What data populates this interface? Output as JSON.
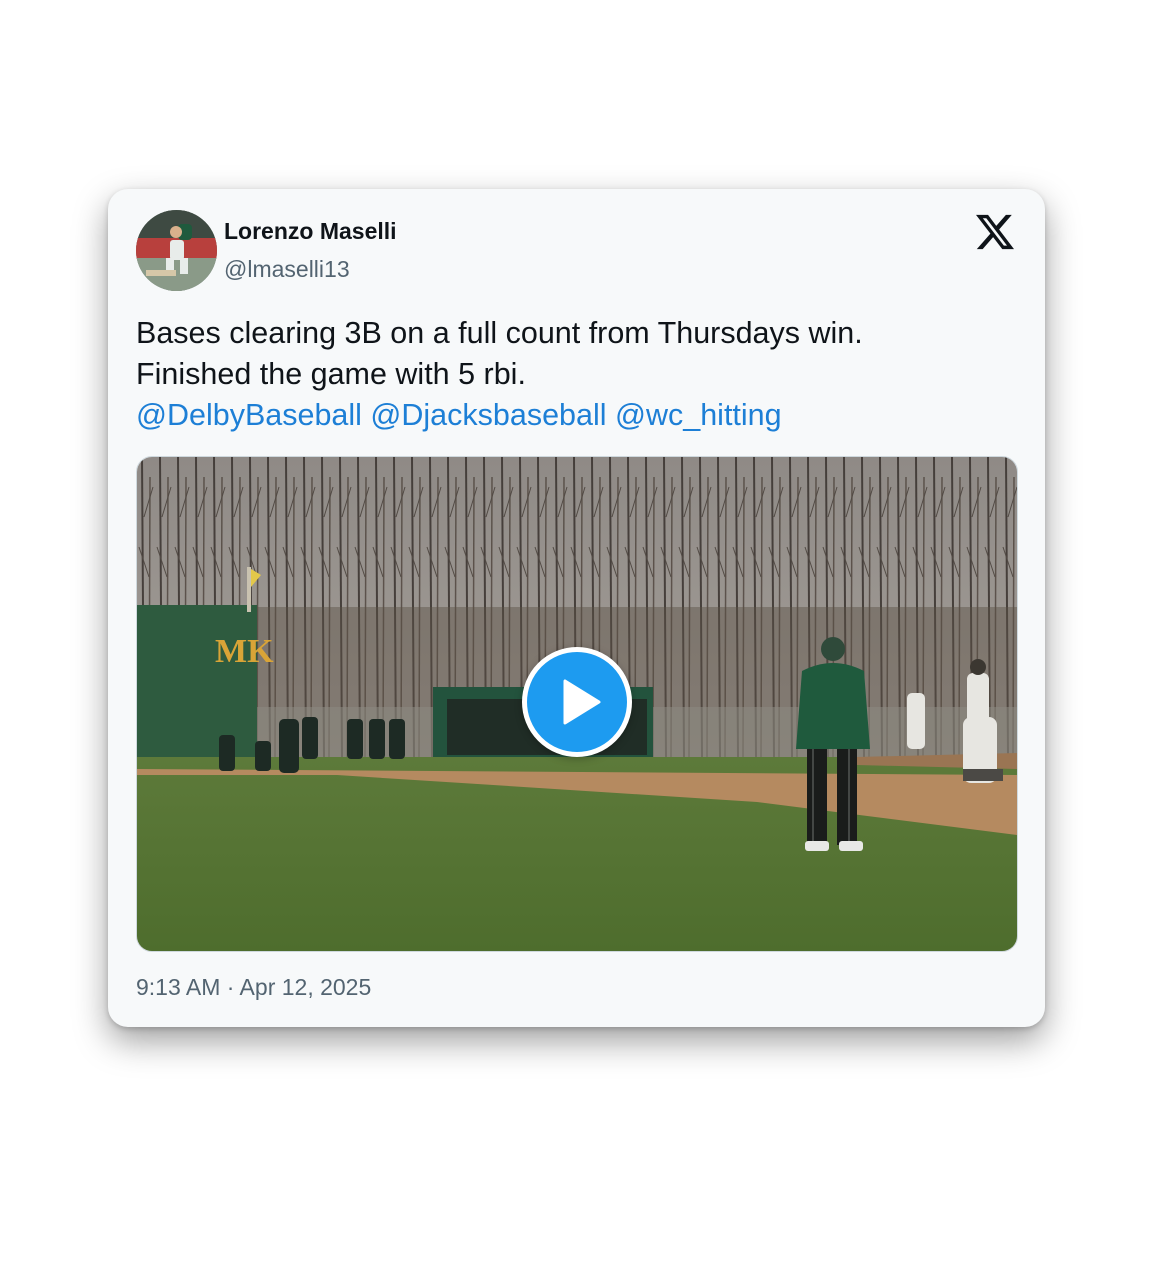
{
  "tweet": {
    "author_name": "Lorenzo Maselli",
    "author_handle": "@lmaselli13",
    "text_line1": "Bases clearing 3B on a full count from Thursdays win.",
    "text_line2": "Finished the game with 5 rbi.",
    "mentions": [
      "@DelbyBaseball",
      "@Djacksbaseball",
      "@wc_hitting"
    ],
    "timestamp": "9:13 AM · Apr 12, 2025"
  },
  "media": {
    "type": "video",
    "wall_logo": "MK",
    "play_icon": "play-icon"
  },
  "icons": {
    "brand": "x-logo-icon",
    "avatar": "avatar-image"
  },
  "colors": {
    "card_background": "#f7f9fa",
    "link": "#1d7fd6",
    "text_primary": "#0f1419",
    "text_secondary": "#536471",
    "play_button": "#1d9bf0"
  }
}
